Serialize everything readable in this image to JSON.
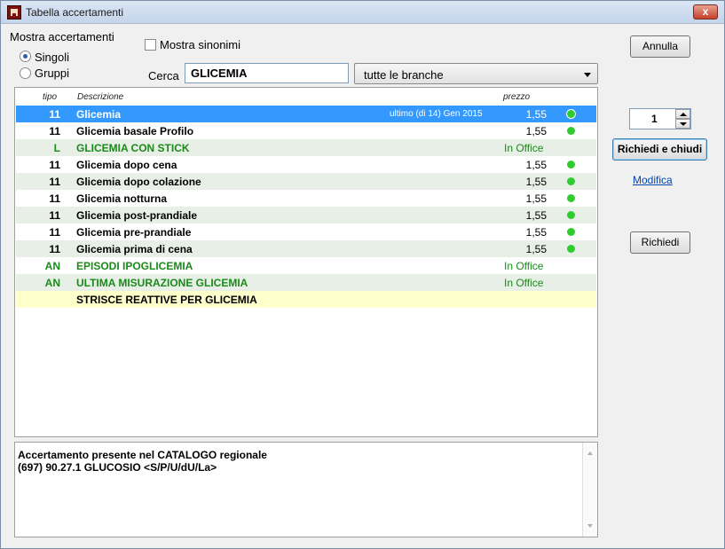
{
  "window": {
    "title": "Tabella accertamenti",
    "close_label": "x"
  },
  "filters": {
    "group_label": "Mostra accertamenti",
    "radio_singoli": "Singoli",
    "radio_gruppi": "Gruppi",
    "selected_radio": "Singoli",
    "checkbox_sinonimi": "Mostra sinonimi",
    "checkbox_sinonimi_checked": false,
    "search_label": "Cerca",
    "search_value": "GLICEMIA",
    "branch_select_value": "tutte le branche"
  },
  "list": {
    "headers": {
      "tipo": "tipo",
      "descrizione": "Descrizione",
      "prezzo": "prezzo"
    },
    "rows": [
      {
        "tipo": "11",
        "desc": "Glicemia",
        "note": "ultimo (di 14) Gen 2015",
        "prezzo": "1,55",
        "status": "dot",
        "style": "selected"
      },
      {
        "tipo": "11",
        "desc": "Glicemia basale Profilo",
        "prezzo": "1,55",
        "status": "dot",
        "style": ""
      },
      {
        "tipo": "L",
        "desc": "GLICEMIA CON STICK",
        "prezzo": "In Office",
        "status": "",
        "style": "alt green"
      },
      {
        "tipo": "11",
        "desc": "Glicemia dopo cena",
        "prezzo": "1,55",
        "status": "dot",
        "style": ""
      },
      {
        "tipo": "11",
        "desc": "Glicemia dopo colazione",
        "prezzo": "1,55",
        "status": "dot",
        "style": "alt"
      },
      {
        "tipo": "11",
        "desc": "Glicemia notturna",
        "prezzo": "1,55",
        "status": "dot",
        "style": ""
      },
      {
        "tipo": "11",
        "desc": "Glicemia post-prandiale",
        "prezzo": "1,55",
        "status": "dot",
        "style": "alt"
      },
      {
        "tipo": "11",
        "desc": "Glicemia pre-prandiale",
        "prezzo": "1,55",
        "status": "dot",
        "style": ""
      },
      {
        "tipo": "11",
        "desc": "Glicemia prima di cena",
        "prezzo": "1,55",
        "status": "dot",
        "style": "alt"
      },
      {
        "tipo": "AN",
        "desc": "EPISODI IPOGLICEMIA",
        "prezzo": "In Office",
        "status": "",
        "style": "green"
      },
      {
        "tipo": "AN",
        "desc": "ULTIMA MISURAZIONE GLICEMIA",
        "prezzo": "In Office",
        "status": "",
        "style": "alt green"
      },
      {
        "tipo": "",
        "desc": "STRISCE REATTIVE PER GLICEMIA",
        "prezzo": "",
        "status": "",
        "style": "yellow"
      }
    ]
  },
  "info": {
    "line1": "Accertamento presente nel CATALOGO regionale",
    "line2": "(697) 90.27.1 GLUCOSIO <S/P/U/dU/La>"
  },
  "side": {
    "annulla": "Annulla",
    "quantity": "1",
    "richiedi_chiudi": "Richiedi e chiudi",
    "modifica": "Modifica",
    "richiedi": "Richiedi"
  },
  "colors": {
    "selection": "#3399ff",
    "in_office_green": "#1a8a1a",
    "status_dot": "#2ecc2e",
    "highlight_row": "#ffffcc"
  }
}
